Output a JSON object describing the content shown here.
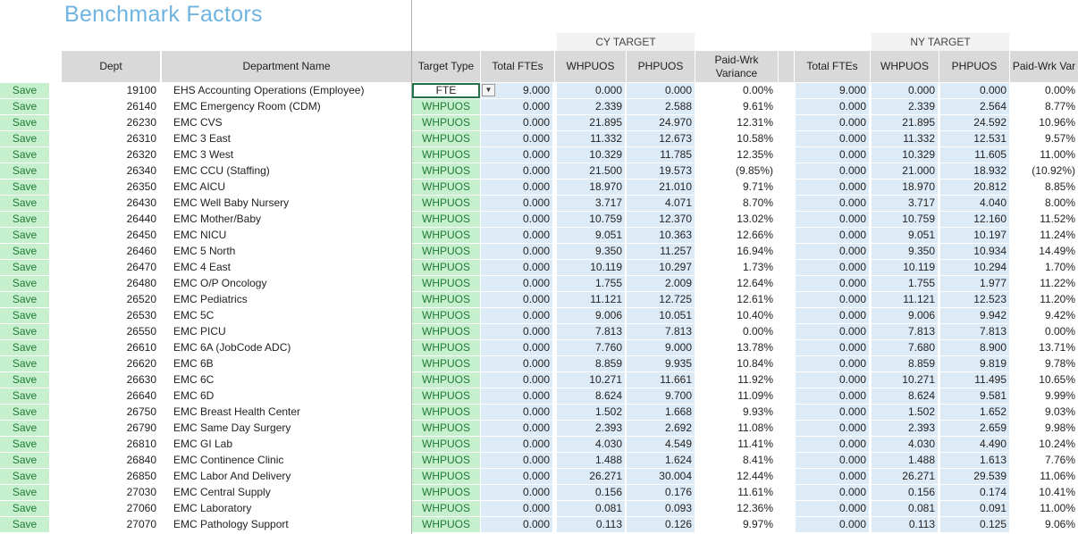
{
  "sheet": {
    "title": "Benchmark Factors"
  },
  "groups": {
    "cy": "CY TARGET",
    "ny": "NY TARGET"
  },
  "headers": {
    "dept": "Dept",
    "department_name": "Department Name",
    "target_type": "Target Type",
    "cy_total_ftes": "Total FTEs",
    "cy_whpuos": "WHPUOS",
    "cy_phpuos": "PHPUOS",
    "cy_variance_1": "Paid-Wrk",
    "cy_variance_2": "Variance",
    "ny_total_ftes": "Total FTEs",
    "ny_whpuos": "WHPUOS",
    "ny_phpuos": "PHPUOS",
    "ny_variance": "Paid-Wrk Var"
  },
  "save_label": "Save",
  "dropdown_glyph": "▼",
  "colors": {
    "title": "#6fb3e0",
    "save_bg": "#c6efce",
    "save_text": "#1e7b34",
    "value_bg": "#ddebf7",
    "header_bg": "#d9d9d9"
  },
  "rows": [
    {
      "dept": "19100",
      "name": "EHS Accounting Operations (Employee)",
      "type": "FTE",
      "cy_fte": "9.000",
      "cy_wh": "0.000",
      "cy_ph": "0.000",
      "cy_var": "0.00%",
      "ny_fte": "9.000",
      "ny_wh": "0.000",
      "ny_ph": "0.000",
      "ny_var": "0.00%"
    },
    {
      "dept": "26140",
      "name": "EMC Emergency Room (CDM)",
      "type": "WHPUOS",
      "cy_fte": "0.000",
      "cy_wh": "2.339",
      "cy_ph": "2.588",
      "cy_var": "9.61%",
      "ny_fte": "0.000",
      "ny_wh": "2.339",
      "ny_ph": "2.564",
      "ny_var": "8.77%"
    },
    {
      "dept": "26230",
      "name": "EMC CVS",
      "type": "WHPUOS",
      "cy_fte": "0.000",
      "cy_wh": "21.895",
      "cy_ph": "24.970",
      "cy_var": "12.31%",
      "ny_fte": "0.000",
      "ny_wh": "21.895",
      "ny_ph": "24.592",
      "ny_var": "10.96%"
    },
    {
      "dept": "26310",
      "name": "EMC 3 East",
      "type": "WHPUOS",
      "cy_fte": "0.000",
      "cy_wh": "11.332",
      "cy_ph": "12.673",
      "cy_var": "10.58%",
      "ny_fte": "0.000",
      "ny_wh": "11.332",
      "ny_ph": "12.531",
      "ny_var": "9.57%"
    },
    {
      "dept": "26320",
      "name": "EMC 3 West",
      "type": "WHPUOS",
      "cy_fte": "0.000",
      "cy_wh": "10.329",
      "cy_ph": "11.785",
      "cy_var": "12.35%",
      "ny_fte": "0.000",
      "ny_wh": "10.329",
      "ny_ph": "11.605",
      "ny_var": "11.00%"
    },
    {
      "dept": "26340",
      "name": "EMC CCU (Staffing)",
      "type": "WHPUOS",
      "cy_fte": "0.000",
      "cy_wh": "21.500",
      "cy_ph": "19.573",
      "cy_var": "(9.85%)",
      "ny_fte": "0.000",
      "ny_wh": "21.000",
      "ny_ph": "18.932",
      "ny_var": "(10.92%)"
    },
    {
      "dept": "26350",
      "name": "EMC AICU",
      "type": "WHPUOS",
      "cy_fte": "0.000",
      "cy_wh": "18.970",
      "cy_ph": "21.010",
      "cy_var": "9.71%",
      "ny_fte": "0.000",
      "ny_wh": "18.970",
      "ny_ph": "20.812",
      "ny_var": "8.85%"
    },
    {
      "dept": "26430",
      "name": "EMC Well Baby Nursery",
      "type": "WHPUOS",
      "cy_fte": "0.000",
      "cy_wh": "3.717",
      "cy_ph": "4.071",
      "cy_var": "8.70%",
      "ny_fte": "0.000",
      "ny_wh": "3.717",
      "ny_ph": "4.040",
      "ny_var": "8.00%"
    },
    {
      "dept": "26440",
      "name": "EMC Mother/Baby",
      "type": "WHPUOS",
      "cy_fte": "0.000",
      "cy_wh": "10.759",
      "cy_ph": "12.370",
      "cy_var": "13.02%",
      "ny_fte": "0.000",
      "ny_wh": "10.759",
      "ny_ph": "12.160",
      "ny_var": "11.52%"
    },
    {
      "dept": "26450",
      "name": "EMC NICU",
      "type": "WHPUOS",
      "cy_fte": "0.000",
      "cy_wh": "9.051",
      "cy_ph": "10.363",
      "cy_var": "12.66%",
      "ny_fte": "0.000",
      "ny_wh": "9.051",
      "ny_ph": "10.197",
      "ny_var": "11.24%"
    },
    {
      "dept": "26460",
      "name": "EMC 5 North",
      "type": "WHPUOS",
      "cy_fte": "0.000",
      "cy_wh": "9.350",
      "cy_ph": "11.257",
      "cy_var": "16.94%",
      "ny_fte": "0.000",
      "ny_wh": "9.350",
      "ny_ph": "10.934",
      "ny_var": "14.49%"
    },
    {
      "dept": "26470",
      "name": "EMC 4 East",
      "type": "WHPUOS",
      "cy_fte": "0.000",
      "cy_wh": "10.119",
      "cy_ph": "10.297",
      "cy_var": "1.73%",
      "ny_fte": "0.000",
      "ny_wh": "10.119",
      "ny_ph": "10.294",
      "ny_var": "1.70%"
    },
    {
      "dept": "26480",
      "name": "EMC O/P Oncology",
      "type": "WHPUOS",
      "cy_fte": "0.000",
      "cy_wh": "1.755",
      "cy_ph": "2.009",
      "cy_var": "12.64%",
      "ny_fte": "0.000",
      "ny_wh": "1.755",
      "ny_ph": "1.977",
      "ny_var": "11.22%"
    },
    {
      "dept": "26520",
      "name": "EMC Pediatrics",
      "type": "WHPUOS",
      "cy_fte": "0.000",
      "cy_wh": "11.121",
      "cy_ph": "12.725",
      "cy_var": "12.61%",
      "ny_fte": "0.000",
      "ny_wh": "11.121",
      "ny_ph": "12.523",
      "ny_var": "11.20%"
    },
    {
      "dept": "26530",
      "name": "EMC 5C",
      "type": "WHPUOS",
      "cy_fte": "0.000",
      "cy_wh": "9.006",
      "cy_ph": "10.051",
      "cy_var": "10.40%",
      "ny_fte": "0.000",
      "ny_wh": "9.006",
      "ny_ph": "9.942",
      "ny_var": "9.42%"
    },
    {
      "dept": "26550",
      "name": "EMC PICU",
      "type": "WHPUOS",
      "cy_fte": "0.000",
      "cy_wh": "7.813",
      "cy_ph": "7.813",
      "cy_var": "0.00%",
      "ny_fte": "0.000",
      "ny_wh": "7.813",
      "ny_ph": "7.813",
      "ny_var": "0.00%"
    },
    {
      "dept": "26610",
      "name": "EMC 6A (JobCode ADC)",
      "type": "WHPUOS",
      "cy_fte": "0.000",
      "cy_wh": "7.760",
      "cy_ph": "9.000",
      "cy_var": "13.78%",
      "ny_fte": "0.000",
      "ny_wh": "7.680",
      "ny_ph": "8.900",
      "ny_var": "13.71%"
    },
    {
      "dept": "26620",
      "name": "EMC 6B",
      "type": "WHPUOS",
      "cy_fte": "0.000",
      "cy_wh": "8.859",
      "cy_ph": "9.935",
      "cy_var": "10.84%",
      "ny_fte": "0.000",
      "ny_wh": "8.859",
      "ny_ph": "9.819",
      "ny_var": "9.78%"
    },
    {
      "dept": "26630",
      "name": "EMC 6C",
      "type": "WHPUOS",
      "cy_fte": "0.000",
      "cy_wh": "10.271",
      "cy_ph": "11.661",
      "cy_var": "11.92%",
      "ny_fte": "0.000",
      "ny_wh": "10.271",
      "ny_ph": "11.495",
      "ny_var": "10.65%"
    },
    {
      "dept": "26640",
      "name": "EMC 6D",
      "type": "WHPUOS",
      "cy_fte": "0.000",
      "cy_wh": "8.624",
      "cy_ph": "9.700",
      "cy_var": "11.09%",
      "ny_fte": "0.000",
      "ny_wh": "8.624",
      "ny_ph": "9.581",
      "ny_var": "9.99%"
    },
    {
      "dept": "26750",
      "name": "EMC Breast Health Center",
      "type": "WHPUOS",
      "cy_fte": "0.000",
      "cy_wh": "1.502",
      "cy_ph": "1.668",
      "cy_var": "9.93%",
      "ny_fte": "0.000",
      "ny_wh": "1.502",
      "ny_ph": "1.652",
      "ny_var": "9.03%"
    },
    {
      "dept": "26790",
      "name": "EMC Same Day Surgery",
      "type": "WHPUOS",
      "cy_fte": "0.000",
      "cy_wh": "2.393",
      "cy_ph": "2.692",
      "cy_var": "11.08%",
      "ny_fte": "0.000",
      "ny_wh": "2.393",
      "ny_ph": "2.659",
      "ny_var": "9.98%"
    },
    {
      "dept": "26810",
      "name": "EMC GI Lab",
      "type": "WHPUOS",
      "cy_fte": "0.000",
      "cy_wh": "4.030",
      "cy_ph": "4.549",
      "cy_var": "11.41%",
      "ny_fte": "0.000",
      "ny_wh": "4.030",
      "ny_ph": "4.490",
      "ny_var": "10.24%"
    },
    {
      "dept": "26840",
      "name": "EMC Continence Clinic",
      "type": "WHPUOS",
      "cy_fte": "0.000",
      "cy_wh": "1.488",
      "cy_ph": "1.624",
      "cy_var": "8.41%",
      "ny_fte": "0.000",
      "ny_wh": "1.488",
      "ny_ph": "1.613",
      "ny_var": "7.76%"
    },
    {
      "dept": "26850",
      "name": "EMC Labor And Delivery",
      "type": "WHPUOS",
      "cy_fte": "0.000",
      "cy_wh": "26.271",
      "cy_ph": "30.004",
      "cy_var": "12.44%",
      "ny_fte": "0.000",
      "ny_wh": "26.271",
      "ny_ph": "29.539",
      "ny_var": "11.06%"
    },
    {
      "dept": "27030",
      "name": "EMC Central Supply",
      "type": "WHPUOS",
      "cy_fte": "0.000",
      "cy_wh": "0.156",
      "cy_ph": "0.176",
      "cy_var": "11.61%",
      "ny_fte": "0.000",
      "ny_wh": "0.156",
      "ny_ph": "0.174",
      "ny_var": "10.41%"
    },
    {
      "dept": "27060",
      "name": "EMC Laboratory",
      "type": "WHPUOS",
      "cy_fte": "0.000",
      "cy_wh": "0.081",
      "cy_ph": "0.093",
      "cy_var": "12.36%",
      "ny_fte": "0.000",
      "ny_wh": "0.081",
      "ny_ph": "0.091",
      "ny_var": "11.00%"
    },
    {
      "dept": "27070",
      "name": "EMC Pathology Support",
      "type": "WHPUOS",
      "cy_fte": "0.000",
      "cy_wh": "0.113",
      "cy_ph": "0.126",
      "cy_var": "9.97%",
      "ny_fte": "0.000",
      "ny_wh": "0.113",
      "ny_ph": "0.125",
      "ny_var": "9.06%"
    }
  ]
}
